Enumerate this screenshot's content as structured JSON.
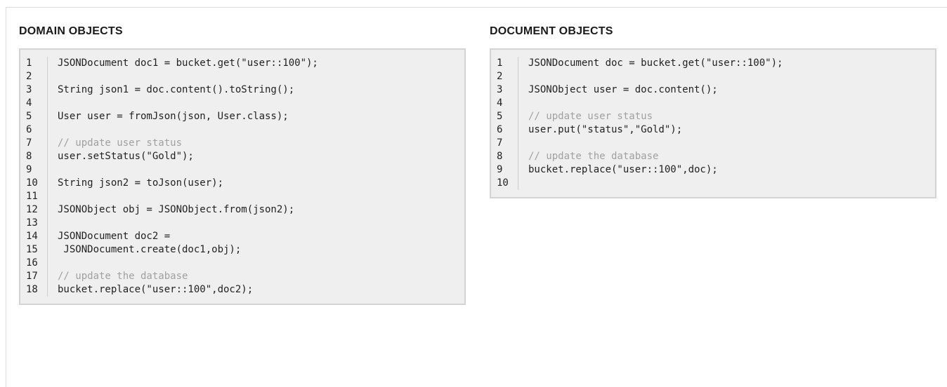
{
  "left_panel": {
    "title": "DOMAIN OBJECTS",
    "lines": [
      {
        "num": "1",
        "text": "JSONDocument doc1 = bucket.get(\"user::100\");",
        "comment": false
      },
      {
        "num": "2",
        "text": "",
        "comment": false
      },
      {
        "num": "3",
        "text": "String json1 = doc.content().toString();",
        "comment": false
      },
      {
        "num": "4",
        "text": "",
        "comment": false
      },
      {
        "num": "5",
        "text": "User user = fromJson(json, User.class);",
        "comment": false
      },
      {
        "num": "6",
        "text": "",
        "comment": false
      },
      {
        "num": "7",
        "text": "// update user status",
        "comment": true
      },
      {
        "num": "8",
        "text": "user.setStatus(\"Gold\");",
        "comment": false
      },
      {
        "num": "9",
        "text": "",
        "comment": false
      },
      {
        "num": "10",
        "text": "String json2 = toJson(user);",
        "comment": false
      },
      {
        "num": "11",
        "text": "",
        "comment": false
      },
      {
        "num": "12",
        "text": "JSONObject obj = JSONObject.from(json2);",
        "comment": false
      },
      {
        "num": "13",
        "text": "",
        "comment": false
      },
      {
        "num": "14",
        "text": "JSONDocument doc2 =",
        "comment": false
      },
      {
        "num": "15",
        "text": " JSONDocument.create(doc1,obj);",
        "comment": false
      },
      {
        "num": "16",
        "text": "",
        "comment": false
      },
      {
        "num": "17",
        "text": "// update the database",
        "comment": true
      },
      {
        "num": "18",
        "text": "bucket.replace(\"user::100\",doc2);",
        "comment": false
      }
    ]
  },
  "right_panel": {
    "title": "DOCUMENT OBJECTS",
    "lines": [
      {
        "num": "1",
        "text": "JSONDocument doc = bucket.get(\"user::100\");",
        "comment": false
      },
      {
        "num": "2",
        "text": "",
        "comment": false
      },
      {
        "num": "3",
        "text": "JSONObject user = doc.content();",
        "comment": false
      },
      {
        "num": "4",
        "text": "",
        "comment": false
      },
      {
        "num": "5",
        "text": "// update user status",
        "comment": true
      },
      {
        "num": "6",
        "text": "user.put(\"status\",\"Gold\");",
        "comment": false
      },
      {
        "num": "7",
        "text": "",
        "comment": false
      },
      {
        "num": "8",
        "text": "// update the database",
        "comment": true
      },
      {
        "num": "9",
        "text": "bucket.replace(\"user::100\",doc);",
        "comment": false
      },
      {
        "num": "10",
        "text": "",
        "comment": false
      }
    ]
  }
}
